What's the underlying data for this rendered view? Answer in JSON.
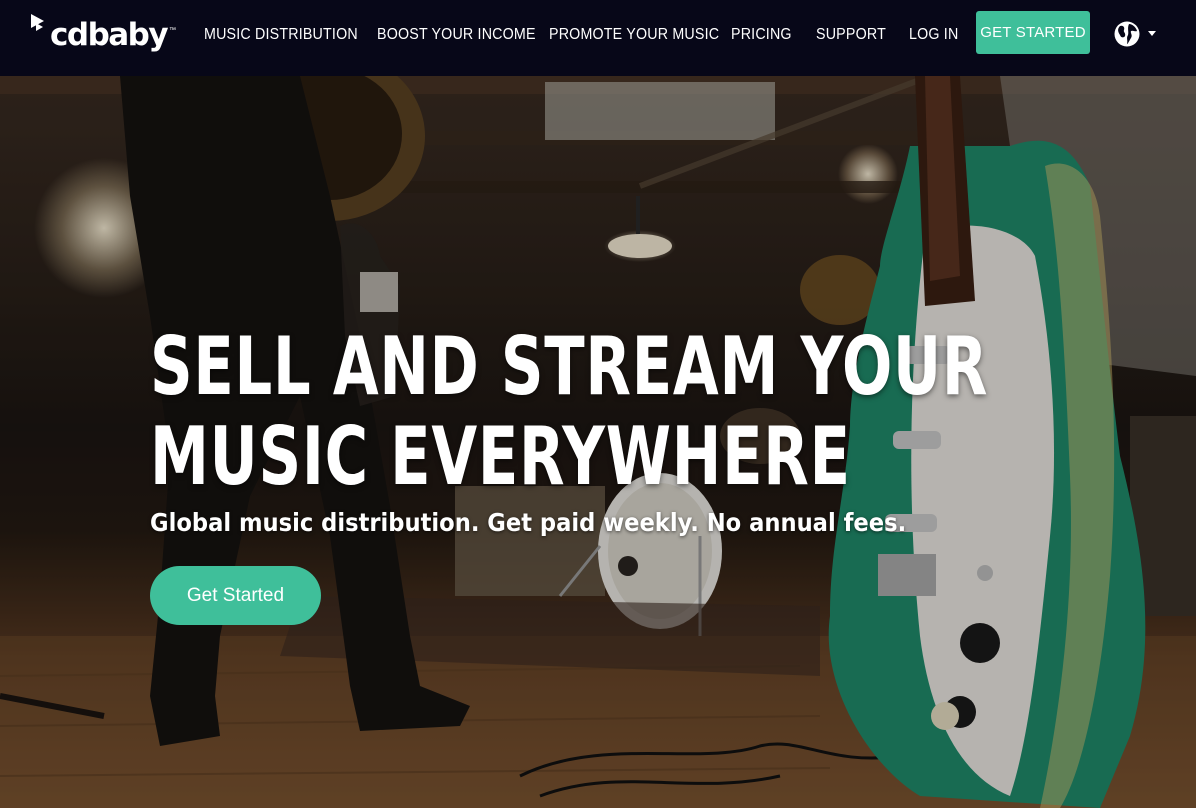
{
  "nav": {
    "logo_text": "cdbaby",
    "logo_trademark": "™",
    "items": [
      {
        "label": "MUSIC DISTRIBUTION"
      },
      {
        "label": "BOOST YOUR INCOME"
      },
      {
        "label": "PROMOTE YOUR MUSIC"
      },
      {
        "label": "PRICING"
      },
      {
        "label": "SUPPORT"
      },
      {
        "label": "LOG IN"
      }
    ],
    "cta_label": "GET STARTED",
    "language_icon": "globe-icon",
    "language_dropdown_icon": "caret-down-icon"
  },
  "hero": {
    "title_line1": "SELL AND STREAM YOUR",
    "title_line2": "MUSIC EVERYWHERE",
    "subtitle": "Global music distribution. Get paid weekly. No annual fees.",
    "cta_label": "Get Started"
  },
  "colors": {
    "nav_background": "#070718",
    "accent": "#3fbf9a",
    "text": "#ffffff",
    "guitar_body": "#1f8a6a"
  }
}
